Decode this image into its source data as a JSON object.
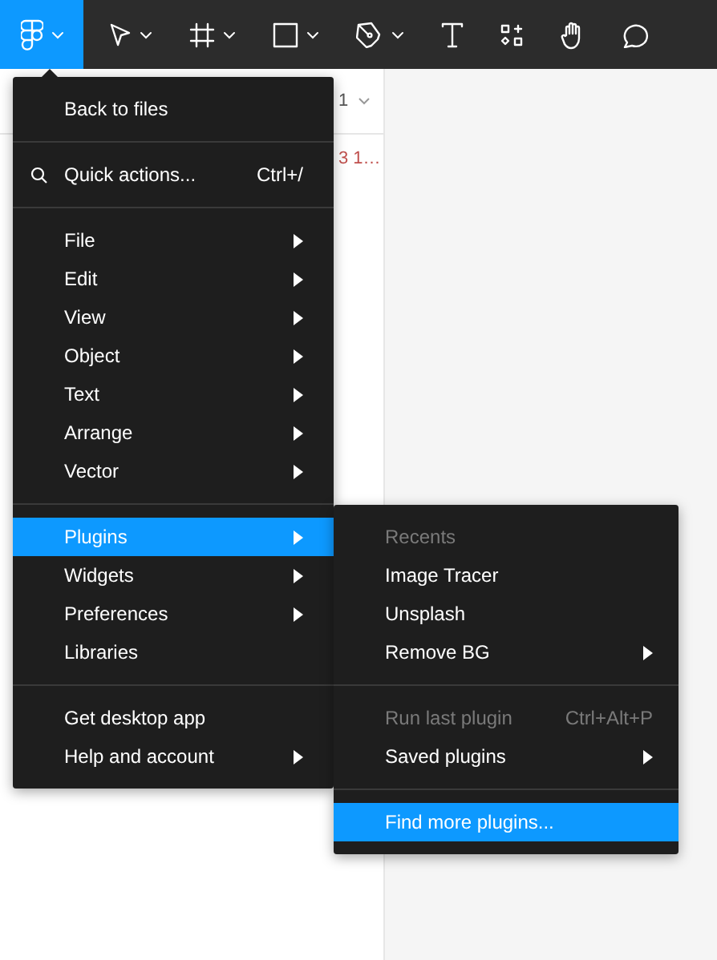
{
  "toolbar": {
    "tools": [
      {
        "kind": "logo",
        "selected": true,
        "dropdown": true
      },
      {
        "kind": "move",
        "selected": false,
        "dropdown": true
      },
      {
        "kind": "frame",
        "selected": false,
        "dropdown": true
      },
      {
        "kind": "rectangle",
        "selected": false,
        "dropdown": true
      },
      {
        "kind": "pen",
        "selected": false,
        "dropdown": true
      },
      {
        "kind": "text",
        "selected": false,
        "dropdown": false
      },
      {
        "kind": "components",
        "selected": false,
        "dropdown": false
      },
      {
        "kind": "hand",
        "selected": false,
        "dropdown": false
      },
      {
        "kind": "comment",
        "selected": false,
        "dropdown": false
      }
    ]
  },
  "panel": {
    "header_text": "1",
    "row_text": "3 1…"
  },
  "main_menu": {
    "sections": [
      {
        "items": [
          {
            "label": "Back to files",
            "selected": false,
            "submenu": false
          }
        ]
      },
      {
        "items": [
          {
            "label": "Quick actions...",
            "selected": false,
            "submenu": false,
            "shortcut": "Ctrl+/"
          }
        ]
      },
      {
        "items": [
          {
            "label": "File",
            "selected": false,
            "submenu": true
          },
          {
            "label": "Edit",
            "selected": false,
            "submenu": true
          },
          {
            "label": "View",
            "selected": false,
            "submenu": true
          },
          {
            "label": "Object",
            "selected": false,
            "submenu": true
          },
          {
            "label": "Text",
            "selected": false,
            "submenu": true
          },
          {
            "label": "Arrange",
            "selected": false,
            "submenu": true
          },
          {
            "label": "Vector",
            "selected": false,
            "submenu": true
          }
        ]
      },
      {
        "items": [
          {
            "label": "Plugins",
            "selected": true,
            "submenu": true
          },
          {
            "label": "Widgets",
            "selected": false,
            "submenu": true
          },
          {
            "label": "Preferences",
            "selected": false,
            "submenu": true
          },
          {
            "label": "Libraries",
            "selected": false,
            "submenu": false
          }
        ]
      },
      {
        "items": [
          {
            "label": "Get desktop app",
            "selected": false,
            "submenu": false
          },
          {
            "label": "Help and account",
            "selected": false,
            "submenu": true
          }
        ]
      }
    ]
  },
  "submenu": {
    "sections": [
      {
        "items": [
          {
            "label": "Recents",
            "selected": false,
            "submenu": false,
            "disabled": true
          },
          {
            "label": "Image Tracer",
            "selected": false,
            "submenu": false,
            "disabled": false
          },
          {
            "label": "Unsplash",
            "selected": false,
            "submenu": false,
            "disabled": false
          },
          {
            "label": "Remove BG",
            "selected": false,
            "submenu": true,
            "disabled": false
          }
        ]
      },
      {
        "items": [
          {
            "label": "Run last plugin",
            "selected": false,
            "submenu": false,
            "disabled": true,
            "shortcut": "Ctrl+Alt+P"
          },
          {
            "label": "Saved plugins",
            "selected": false,
            "submenu": true,
            "disabled": false
          }
        ]
      },
      {
        "items": [
          {
            "label": "Find more plugins...",
            "selected": true,
            "submenu": false,
            "disabled": false
          }
        ]
      }
    ]
  }
}
